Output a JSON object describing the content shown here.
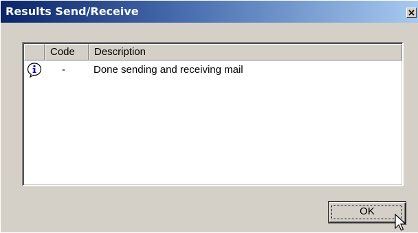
{
  "window": {
    "title": "Results Send/Receive",
    "close_icon": "close-icon"
  },
  "list": {
    "columns": [
      "",
      "Code",
      "Description"
    ],
    "rows": [
      {
        "icon": "info-icon",
        "code": "-",
        "description": "Done sending and receiving mail"
      }
    ]
  },
  "buttons": {
    "ok_label": "OK"
  },
  "colors": {
    "title_gradient_start": "#0a246a",
    "title_gradient_end": "#a6caf0",
    "face": "#d4d0c8",
    "info_icon_blue": "#0000c0"
  },
  "cursor": "arrow-cursor-icon"
}
